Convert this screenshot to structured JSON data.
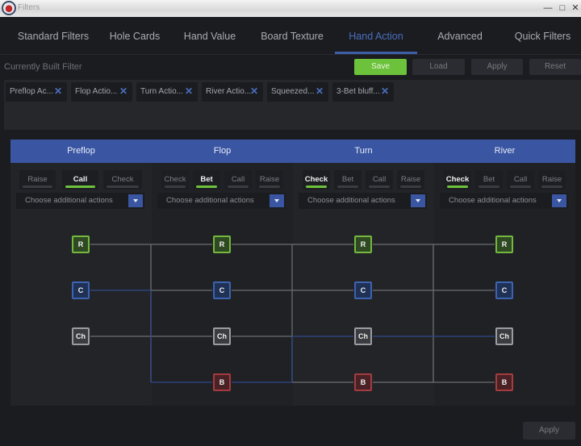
{
  "window": {
    "title": "Filters",
    "controls": [
      "minimize",
      "maximize",
      "close"
    ]
  },
  "tabs": [
    {
      "label": "Standard Filters",
      "active": false
    },
    {
      "label": "Hole Cards",
      "active": false
    },
    {
      "label": "Hand Value",
      "active": false
    },
    {
      "label": "Board Texture",
      "active": false
    },
    {
      "label": "Hand Action",
      "active": true
    },
    {
      "label": "Advanced",
      "active": false
    },
    {
      "label": "Quick Filters",
      "active": false
    }
  ],
  "filter_bar": {
    "label": "Currently Built Filter",
    "buttons": {
      "save": "Save",
      "load": "Load",
      "apply": "Apply",
      "reset": "Reset"
    }
  },
  "chips": [
    {
      "label": "Preflop Ac..."
    },
    {
      "label": "Flop Actio..."
    },
    {
      "label": "Turn Actio..."
    },
    {
      "label": "River Actio..."
    },
    {
      "label": "Squeezed..."
    },
    {
      "label": "3-Bet bluff..."
    }
  ],
  "streets": [
    {
      "name": "Preflop",
      "actions": [
        {
          "label": "Raise",
          "on": false
        },
        {
          "label": "Call",
          "on": true
        },
        {
          "label": "Check",
          "on": false
        }
      ],
      "dropdown": "Choose additional actions"
    },
    {
      "name": "Flop",
      "actions": [
        {
          "label": "Check",
          "on": false
        },
        {
          "label": "Bet",
          "on": true
        },
        {
          "label": "Call",
          "on": false
        },
        {
          "label": "Raise",
          "on": false
        }
      ],
      "dropdown": "Choose additional actions"
    },
    {
      "name": "Turn",
      "actions": [
        {
          "label": "Check",
          "on": true
        },
        {
          "label": "Bet",
          "on": false
        },
        {
          "label": "Call",
          "on": false
        },
        {
          "label": "Raise",
          "on": false
        }
      ],
      "dropdown": "Choose additional actions"
    },
    {
      "name": "River",
      "actions": [
        {
          "label": "Check",
          "on": true
        },
        {
          "label": "Bet",
          "on": false
        },
        {
          "label": "Call",
          "on": false
        },
        {
          "label": "Raise",
          "on": false
        }
      ],
      "dropdown": "Choose additional actions"
    }
  ],
  "tree": {
    "columns": [
      [
        "R",
        "C",
        "Ch"
      ],
      [
        "C",
        "R",
        "Ch",
        "B"
      ],
      [
        "R",
        "C",
        "Ch",
        "B"
      ],
      [
        "C",
        "R",
        "Ch",
        "B"
      ]
    ],
    "selected_path": [
      "C",
      "B",
      "Ch",
      "Ch"
    ]
  },
  "footer": {
    "apply": "Apply"
  },
  "colors": {
    "accent": "#3a56a3",
    "active_green": "#6cc23b",
    "raise": "#74b83f",
    "call": "#3d63b0",
    "check": "#9a9ca1",
    "bet": "#a43c3f"
  }
}
